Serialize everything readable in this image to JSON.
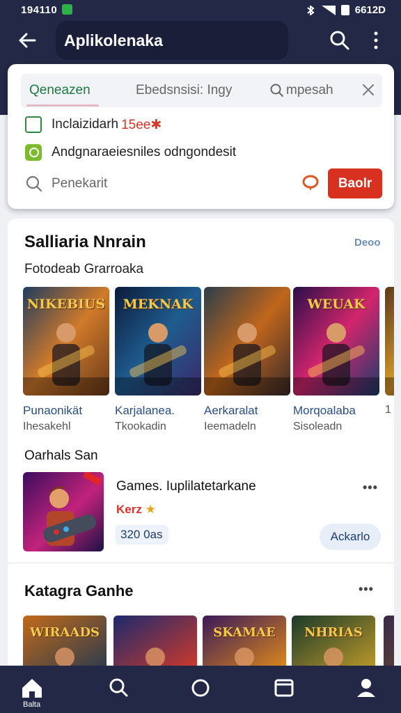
{
  "status": {
    "time": "194110",
    "clock": "6612D"
  },
  "appbar": {
    "title": "Aplikolenaka"
  },
  "search_card": {
    "tabs": [
      {
        "label": "Qeneazen"
      },
      {
        "label": "Ebedsnsisi: Ingy"
      },
      {
        "label": "mpesah"
      }
    ],
    "options": [
      {
        "label": "Inclaizidarh",
        "tag": "15ee✱"
      },
      {
        "label": "Andgnaraeiesniles odngondesit"
      }
    ],
    "search_placeholder": "Penekarit",
    "book_button": "Baolr"
  },
  "section1": {
    "title": "Salliaria Nnrain",
    "more_link": "Deoo",
    "subheading": "Fotodeab Grarroaka",
    "games": [
      {
        "art_title": "NIKEBIUS",
        "name": "Punaonikät",
        "sub": "Ihesakehl",
        "colors": [
          "#1f3c5e",
          "#d07a2a",
          "#6b3a1a"
        ]
      },
      {
        "art_title": "MEKNAK",
        "name": "Karjalanea.",
        "sub": "Tkookadin",
        "colors": [
          "#0c1c3a",
          "#1f5c8e",
          "#3b2a6a"
        ]
      },
      {
        "art_title": "",
        "name": "Aerkaralat",
        "sub": "Ieemadeln",
        "colors": [
          "#2b3e4a",
          "#c0661c",
          "#3a2a2a"
        ]
      },
      {
        "art_title": "WEUAK",
        "name": "Morqoalaba",
        "sub": "Sisoleadn",
        "colors": [
          "#2a0e4a",
          "#d2256c",
          "#1d3c6e"
        ]
      },
      {
        "art_title": "",
        "name": "",
        "sub": "1",
        "colors": [
          "#5a3a1a",
          "#d89a2a",
          "#2a1a0a"
        ]
      }
    ]
  },
  "section2": {
    "title": "Oarhals San",
    "featured": {
      "title": "Games. Iuplilatetarkane",
      "tag": "Kerz",
      "star": "★",
      "price": "320 0as",
      "button": "Ackarlo"
    }
  },
  "section3": {
    "title": "Katagra Ganhe",
    "thumbs": [
      {
        "art_title": "WIRAADS",
        "colors": [
          "#c06a1a",
          "#2a3a4e"
        ]
      },
      {
        "art_title": "",
        "colors": [
          "#1c2a6e",
          "#d23a2a"
        ]
      },
      {
        "art_title": "SKAMAE",
        "colors": [
          "#3a1a5a",
          "#e08a1a"
        ]
      },
      {
        "art_title": "NHRIAS",
        "colors": [
          "#1a3a2a",
          "#c09a2a"
        ]
      },
      {
        "art_title": "",
        "colors": [
          "#3a2a4a",
          "#6a4a2a"
        ]
      }
    ]
  },
  "bottom_nav": {
    "home_label": "Balta"
  }
}
